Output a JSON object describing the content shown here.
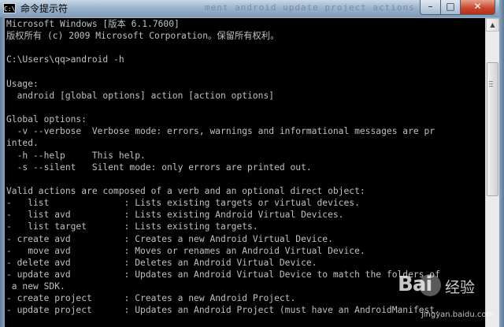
{
  "window": {
    "title": "命令提示符",
    "icon_text": "C:\\",
    "ghost_tabs_text": "ment  android  update  project  actions  ...",
    "controls": {
      "minimize": "–",
      "maximize": "□",
      "close": "✕"
    }
  },
  "console": {
    "lines": [
      "Microsoft Windows [版本 6.1.7600]",
      "版权所有 (c) 2009 Microsoft Corporation。保留所有权利。",
      "",
      "C:\\Users\\qq>android -h",
      "",
      "Usage:",
      "  android [global options] action [action options]",
      "",
      "Global options:",
      "  -v --verbose  Verbose mode: errors, warnings and informational messages are pr",
      "inted.",
      "  -h --help     This help.",
      "  -s --silent   Silent mode: only errors are printed out.",
      "",
      "Valid actions are composed of a verb and an optional direct object:",
      "-   list              : Lists existing targets or virtual devices.",
      "-   list avd          : Lists existing Android Virtual Devices.",
      "-   list target       : Lists existing targets.",
      "- create avd          : Creates a new Android Virtual Device.",
      "-   move avd          : Moves or renames an Android Virtual Device.",
      "- delete avd          : Deletes an Android Virtual Device.",
      "- update avd          : Updates an Android Virtual Device to match the folders of",
      " a new SDK.",
      "- create project      : Creates a new Android Project.",
      "- update project      : Updates an Android Project (must have an AndroidManifest."
    ]
  },
  "watermark": {
    "logo": "Bai",
    "suffix": "经验",
    "url": "jingyan.baidu.com"
  },
  "colors": {
    "console_bg": "#000000",
    "console_fg": "#c0c0c0",
    "close_red": "#c7422b"
  }
}
